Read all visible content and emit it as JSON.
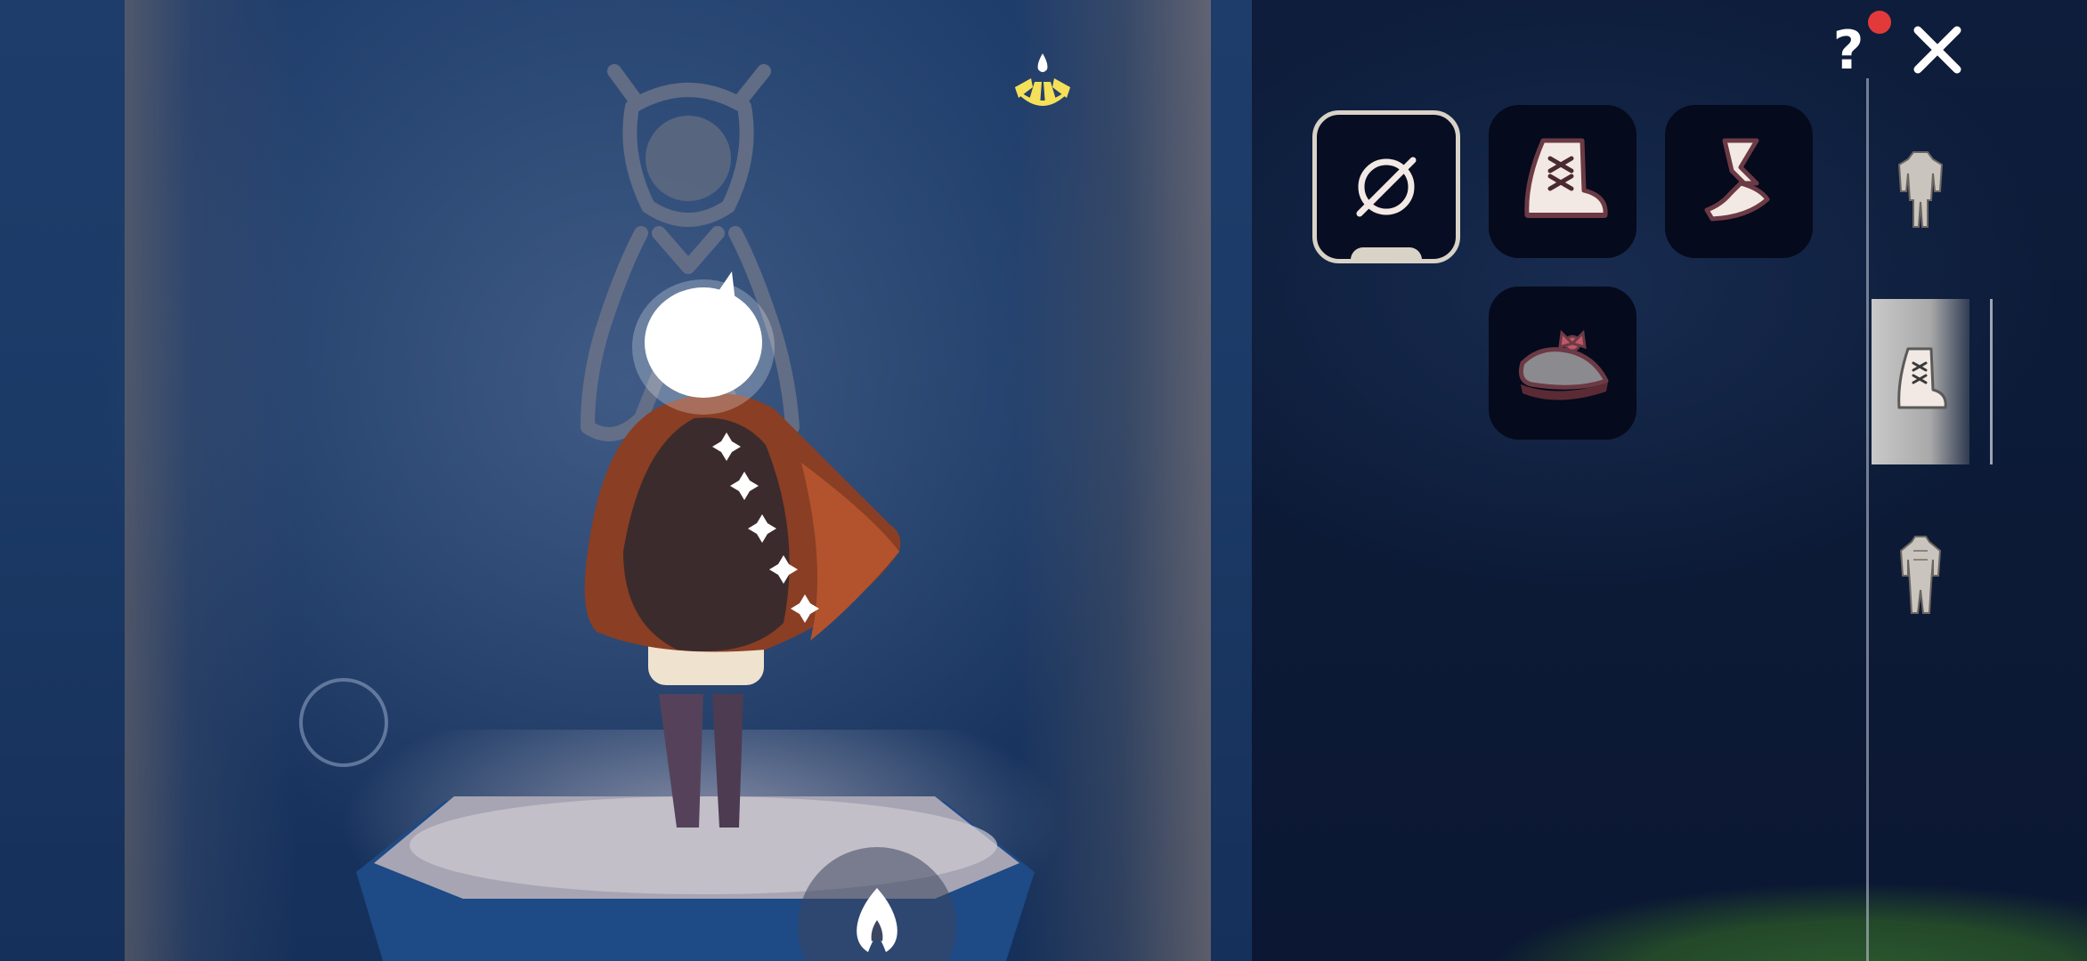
{
  "hud": {
    "joystick_icon": "joystick-ring",
    "action_icon": "flame-icon",
    "candle_icon": "winged-light-fan-icon"
  },
  "closet": {
    "help_label": "?",
    "help_notification": true,
    "close_icon": "close-icon",
    "items": [
      {
        "id": "none",
        "icon": "none-icon",
        "selected": true
      },
      {
        "id": "laced-boots",
        "icon": "laced-boot-icon",
        "selected": false
      },
      {
        "id": "strappy-sandal",
        "icon": "strappy-sandal-icon",
        "selected": false
      },
      {
        "id": "bow-mary-jane",
        "icon": "mary-jane-shoe-icon",
        "selected": false
      }
    ],
    "categories": [
      {
        "id": "outfit",
        "icon": "outfit-icon",
        "active": false
      },
      {
        "id": "shoes",
        "icon": "boot-icon",
        "active": true
      },
      {
        "id": "outfit-alt",
        "icon": "outfit-alt-icon",
        "active": false
      }
    ],
    "colors": {
      "slot_bg": "#050a1c",
      "selected_border": "#d9d2c6",
      "notification": "#e23a3a",
      "icon_cream": "#f3e9e4",
      "icon_outline": "#6b3a44"
    }
  }
}
